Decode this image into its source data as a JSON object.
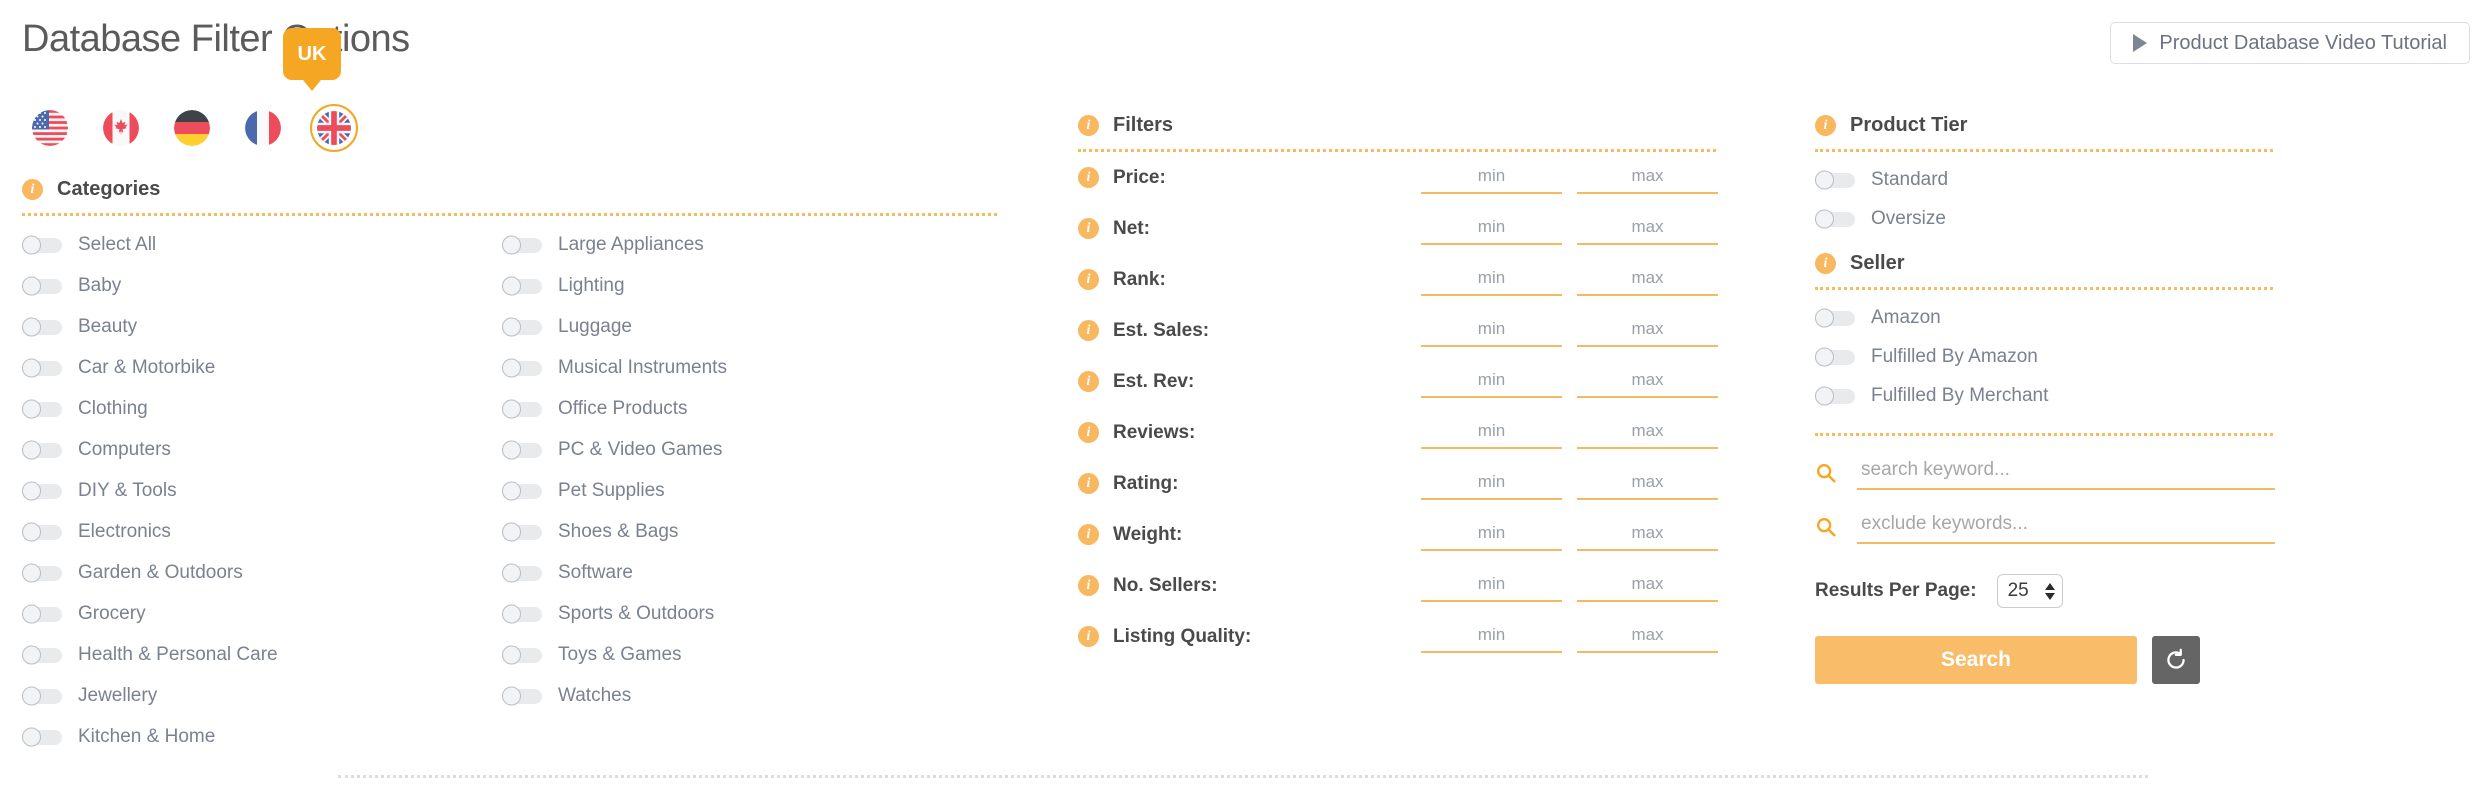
{
  "header": {
    "title": "Database Filter Options",
    "selected_marketplace_badge": "UK",
    "tutorial_button": "Product Database Video Tutorial",
    "play_icon": "play-icon"
  },
  "marketplaces": [
    {
      "code": "US",
      "name": "United States",
      "selected": false
    },
    {
      "code": "CA",
      "name": "Canada",
      "selected": false
    },
    {
      "code": "DE",
      "name": "Germany",
      "selected": false
    },
    {
      "code": "FR",
      "name": "France",
      "selected": false
    },
    {
      "code": "UK",
      "name": "United Kingdom",
      "selected": true
    }
  ],
  "categories": {
    "heading": "Categories",
    "info_icon": "info-icon",
    "left": [
      "Select All",
      "Baby",
      "Beauty",
      "Car & Motorbike",
      "Clothing",
      "Computers",
      "DIY & Tools",
      "Electronics",
      "Garden & Outdoors",
      "Grocery",
      "Health & Personal Care",
      "Jewellery",
      "Kitchen & Home"
    ],
    "right": [
      "Large Appliances",
      "Lighting",
      "Luggage",
      "Musical Instruments",
      "Office Products",
      "PC & Video Games",
      "Pet Supplies",
      "Shoes & Bags",
      "Software",
      "Sports & Outdoors",
      "Toys & Games",
      "Watches"
    ]
  },
  "filters": {
    "heading": "Filters",
    "info_icon": "info-icon",
    "min_placeholder": "min",
    "max_placeholder": "max",
    "rows": [
      {
        "label": "Price:",
        "min": "",
        "max": ""
      },
      {
        "label": "Net:",
        "min": "",
        "max": ""
      },
      {
        "label": "Rank:",
        "min": "",
        "max": ""
      },
      {
        "label": "Est. Sales:",
        "min": "",
        "max": ""
      },
      {
        "label": "Est. Rev:",
        "min": "",
        "max": ""
      },
      {
        "label": "Reviews:",
        "min": "",
        "max": ""
      },
      {
        "label": "Rating:",
        "min": "",
        "max": ""
      },
      {
        "label": "Weight:",
        "min": "",
        "max": ""
      },
      {
        "label": "No. Sellers:",
        "min": "",
        "max": ""
      },
      {
        "label": "Listing Quality:",
        "min": "",
        "max": ""
      }
    ]
  },
  "product_tier": {
    "heading": "Product Tier",
    "info_icon": "info-icon",
    "items": [
      "Standard",
      "Oversize"
    ]
  },
  "seller": {
    "heading": "Seller",
    "info_icon": "info-icon",
    "items": [
      "Amazon",
      "Fulfilled By Amazon",
      "Fulfilled By Merchant"
    ]
  },
  "search": {
    "keyword_placeholder": "search keyword...",
    "keyword_value": "",
    "exclude_placeholder": "exclude keywords...",
    "exclude_value": "",
    "search_icon": "search-icon",
    "results_per_page_label": "Results Per Page:",
    "results_per_page_value": "25",
    "search_button": "Search",
    "reset_icon": "reset-icon"
  },
  "colors": {
    "accent": "#f5a623",
    "accent_light": "#f9bd6a",
    "underline": "#f5b963",
    "label_text": "#4a4a4a",
    "toggle_text": "#7a818f",
    "reset_button": "#656565"
  }
}
